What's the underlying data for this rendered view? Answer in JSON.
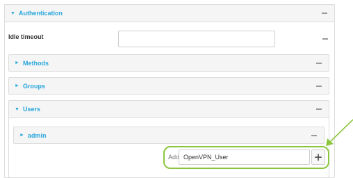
{
  "authentication": {
    "title": "Authentication",
    "arrow": "down",
    "idle_timeout": {
      "label": "Idle timeout",
      "value": "",
      "placeholder": ""
    }
  },
  "sections": {
    "methods": {
      "title": "Methods",
      "arrow": "right"
    },
    "groups": {
      "title": "Groups",
      "arrow": "right"
    },
    "users": {
      "title": "Users",
      "arrow": "down",
      "admin": {
        "title": "admin",
        "arrow": "right"
      },
      "add": {
        "label": "Add",
        "value": "OpenVPN_User",
        "button_icon": "plus-icon"
      }
    }
  },
  "glyphs": {
    "expanded": "▼",
    "collapsed": "►",
    "plus": "+"
  },
  "colors": {
    "accent": "#29a6dc",
    "highlight": "#8cc63f",
    "header_bg": "#f5f5f5",
    "border": "#dcdcdc"
  },
  "icons": {
    "collapse": "minus-icon",
    "expanded_arrow": "triangle-down-icon",
    "collapsed_arrow": "triangle-right-icon",
    "callout": "arrow-pointer-icon"
  }
}
